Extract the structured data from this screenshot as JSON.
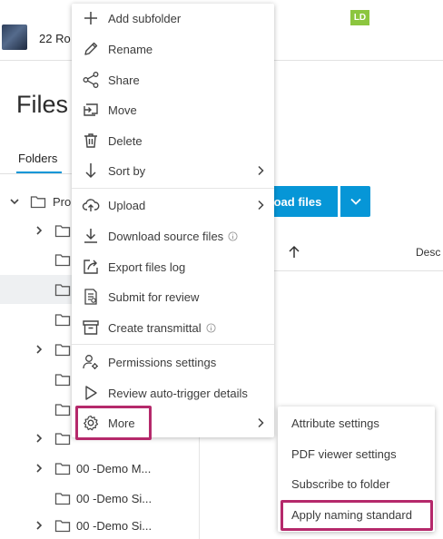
{
  "header": {
    "project_name": "22 Ro",
    "user_initials": "LD",
    "user_badge_color": "#8cc63f"
  },
  "page": {
    "title": "Files",
    "tab_folders": "Folders"
  },
  "toolbar": {
    "upload_label": "load files",
    "column_description": "Desc"
  },
  "tree": {
    "root_label": "Pro",
    "demo_1": "00 -Demo M...",
    "demo_2": "00 -Demo Si...",
    "demo_3": "00 -Demo Si..."
  },
  "context_menu": {
    "items": [
      {
        "label": "Add subfolder",
        "icon": "plus-icon"
      },
      {
        "label": "Rename",
        "icon": "pencil-icon"
      },
      {
        "label": "Share",
        "icon": "share-icon"
      },
      {
        "label": "Move",
        "icon": "move-icon"
      },
      {
        "label": "Delete",
        "icon": "trash-icon"
      },
      {
        "label": "Sort by",
        "icon": "sort-down-icon"
      },
      {
        "label": "Upload",
        "icon": "cloud-upload-icon"
      },
      {
        "label": "Download source files",
        "icon": "download-icon"
      },
      {
        "label": "Export files log",
        "icon": "export-icon"
      },
      {
        "label": "Submit for review",
        "icon": "review-doc-icon"
      },
      {
        "label": "Create transmittal",
        "icon": "transmittal-icon"
      },
      {
        "label": "Permissions settings",
        "icon": "user-gear-icon"
      },
      {
        "label": "Review auto-trigger details",
        "icon": "play-icon"
      },
      {
        "label": "More",
        "icon": "gear-icon"
      }
    ]
  },
  "more_submenu": {
    "items": [
      {
        "label": "Attribute settings"
      },
      {
        "label": "PDF viewer settings"
      },
      {
        "label": "Subscribe to folder"
      },
      {
        "label": "Apply naming standard"
      }
    ]
  },
  "colors": {
    "accent": "#0696d7",
    "highlight": "#b5296b"
  }
}
